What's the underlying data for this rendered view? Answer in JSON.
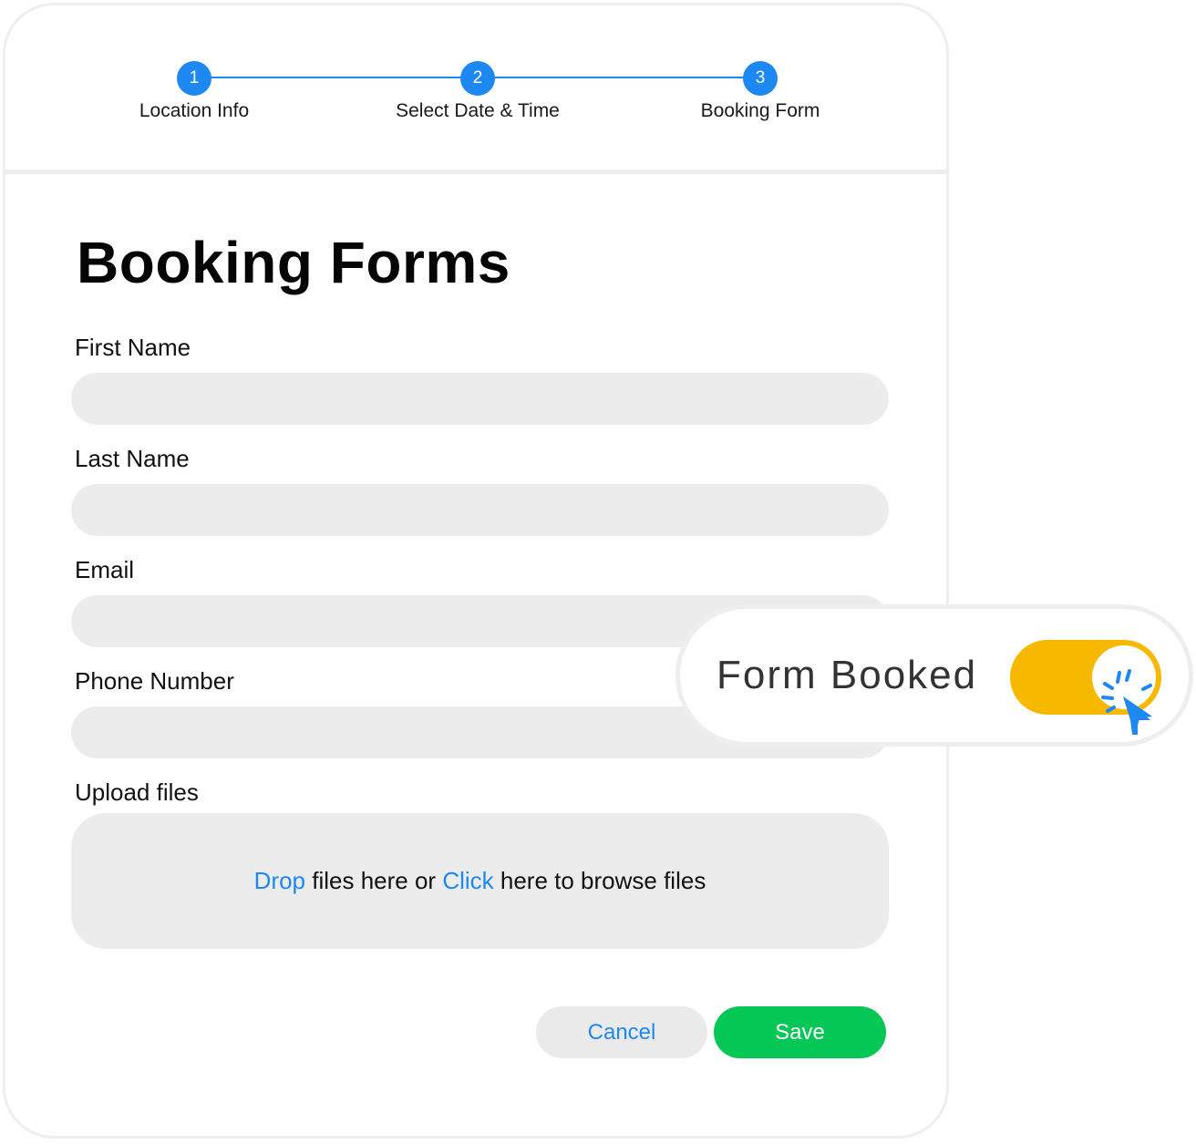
{
  "stepper": {
    "steps": [
      {
        "number": "1",
        "label": "Location Info"
      },
      {
        "number": "2",
        "label": "Select Date & Time"
      },
      {
        "number": "3",
        "label": "Booking Form"
      }
    ]
  },
  "form": {
    "title": "Booking Forms",
    "fields": {
      "first_name": {
        "label": "First Name",
        "value": ""
      },
      "last_name": {
        "label": "Last Name",
        "value": ""
      },
      "email": {
        "label": "Email",
        "value": ""
      },
      "phone": {
        "label": "Phone Number",
        "value": ""
      }
    },
    "upload": {
      "label": "Upload files",
      "drop_link": "Drop",
      "text_middle": " files here or ",
      "click_link": "Click",
      "text_end": " here to browse files"
    },
    "buttons": {
      "cancel": "Cancel",
      "save": "Save"
    }
  },
  "toast": {
    "label": "Form Booked",
    "toggle_on": true
  },
  "colors": {
    "accent": "#1e88f2",
    "save": "#05c755",
    "toggle": "#f7b900"
  },
  "icons": {
    "cursor": "pointer-click-icon"
  }
}
